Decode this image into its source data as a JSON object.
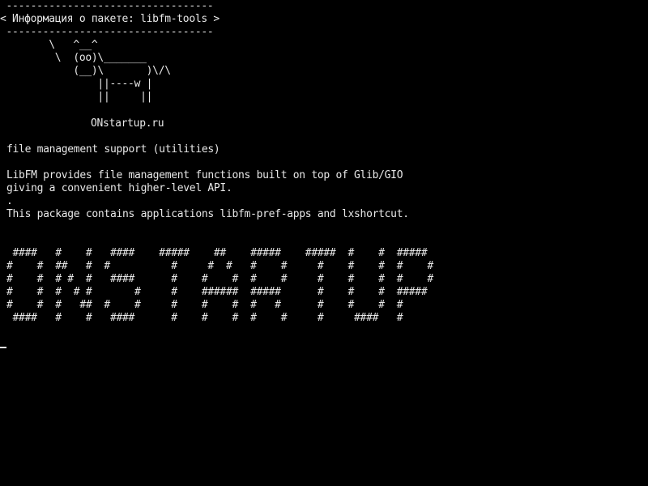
{
  "colors": {
    "background": "#000000",
    "foreground": "#e8e8e8"
  },
  "cowsay": {
    "border_top": " ----------------------------------",
    "message": "< Информация о пакете: libfm-tools >",
    "border_bottom": " ----------------------------------",
    "cow_line_1": "        \\   ^__^",
    "cow_line_2": "         \\  (oo)\\_______",
    "cow_line_3": "            (__)\\       )\\/\\",
    "cow_line_4": "                ||----w |",
    "cow_line_5": "                ||     ||",
    "signature": "ONstartup.ru"
  },
  "package": {
    "summary": "file management support (utilities)",
    "description_line_1": "LibFM provides file management functions built on top of Glib/GIO",
    "description_line_2": "giving a convenient higher-level API.",
    "separator": ".",
    "description_line_3": "This package contains applications libfm-pref-apps and lxshortcut."
  },
  "banner": {
    "line_1": " ####   #    #   ####    #####    ##    #####    #####  #    #  #####",
    "line_2": "#    #  ##   #  #          #     #  #   #    #     #    #    #  #    #",
    "line_3": "#    #  # #  #   ####      #    #    #  #    #     #    #    #  #    #",
    "line_4": "#    #  #  # #       #     #    ######  #####      #    #    #  #####",
    "line_5": "#    #  #   ##  #    #     #    #    #  #   #      #    #    #  #",
    "line_6": " ####   #    #   ####      #    #    #  #    #     #     ####   #"
  },
  "cursor": {
    "glyph": "cursor-icon"
  }
}
